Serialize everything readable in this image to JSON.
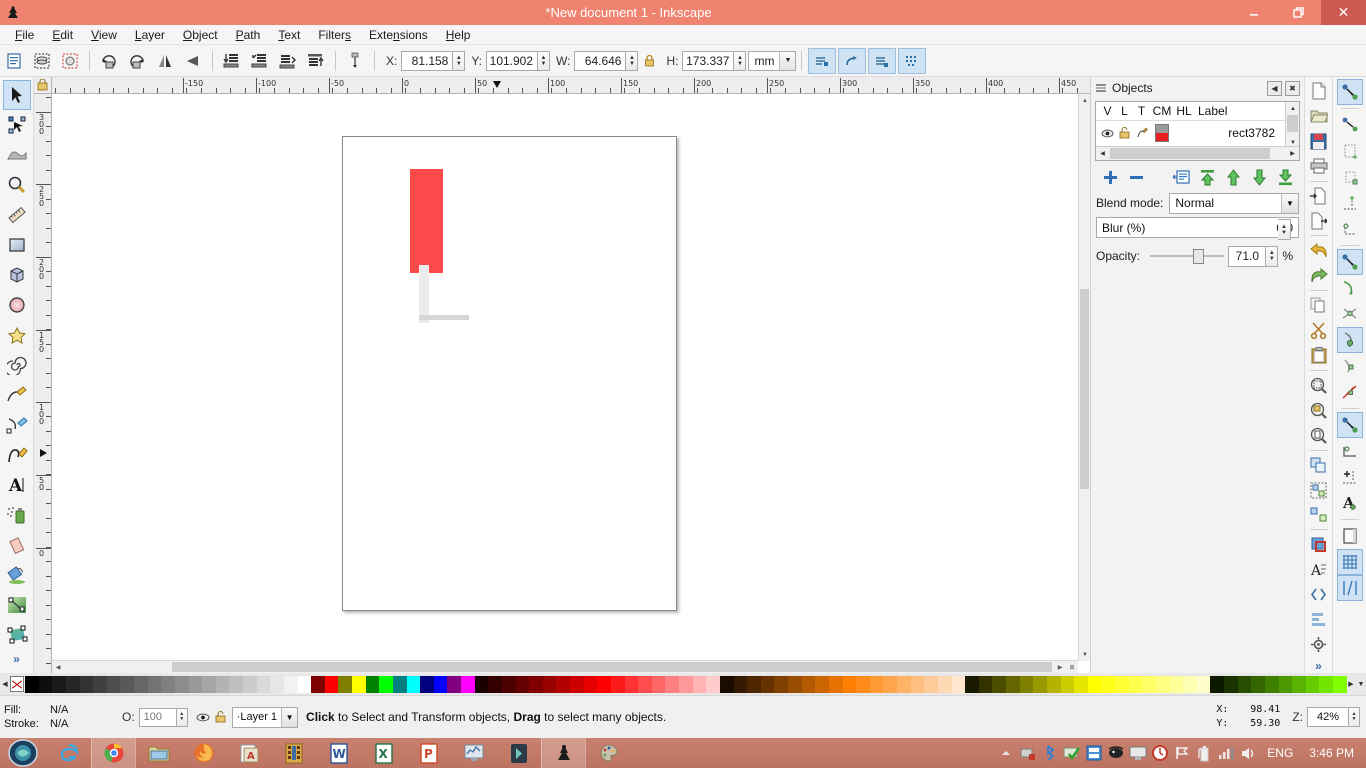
{
  "window": {
    "title": "*New document 1 - Inkscape",
    "app_icon": "inkscape-icon",
    "minimize": "–",
    "maximize": "❐",
    "close": "✕",
    "titlebar_color": "#f0836f",
    "close_color": "#cc5a52"
  },
  "menubar": {
    "items": [
      {
        "label": "File",
        "mnemonic": "F"
      },
      {
        "label": "Edit",
        "mnemonic": "E"
      },
      {
        "label": "View",
        "mnemonic": "V"
      },
      {
        "label": "Layer",
        "mnemonic": "L"
      },
      {
        "label": "Object",
        "mnemonic": "O"
      },
      {
        "label": "Path",
        "mnemonic": "P"
      },
      {
        "label": "Text",
        "mnemonic": "T"
      },
      {
        "label": "Filters",
        "mnemonic": "s"
      },
      {
        "label": "Extensions",
        "mnemonic": "n"
      },
      {
        "label": "Help",
        "mnemonic": "H"
      }
    ]
  },
  "toolcontrols": {
    "buttons": [
      {
        "name": "select-all-icon"
      },
      {
        "name": "select-all-in-all-layers-icon"
      },
      {
        "name": "deselect-icon"
      },
      {
        "name": "rotate-90-ccw-icon"
      },
      {
        "name": "rotate-90-cw-icon"
      },
      {
        "name": "flip-horizontal-icon"
      },
      {
        "name": "flip-vertical-icon"
      },
      {
        "name": "lower-to-bottom-icon"
      },
      {
        "name": "lower-icon"
      },
      {
        "name": "raise-icon"
      },
      {
        "name": "raise-to-top-icon"
      }
    ],
    "x_label": "X:",
    "x_value": "81.158",
    "y_label": "Y:",
    "y_value": "101.902",
    "w_label": "W:",
    "w_value": "64.646",
    "lock_icon": "lock-ratio-icon",
    "h_label": "H:",
    "h_value": "173.337",
    "unit": "mm",
    "affect_buttons": [
      {
        "name": "affect-stroke-width-icon"
      },
      {
        "name": "affect-rounded-corners-icon"
      },
      {
        "name": "affect-gradients-icon"
      },
      {
        "name": "affect-patterns-icon"
      }
    ]
  },
  "toolbox": {
    "tools": [
      {
        "name": "selector-tool",
        "icon": "arrow-cursor-icon",
        "active": true
      },
      {
        "name": "node-tool",
        "icon": "node-editor-icon",
        "active": false
      },
      {
        "name": "tweak-tool",
        "icon": "tweak-icon",
        "active": false
      },
      {
        "name": "zoom-tool",
        "icon": "magnifier-icon",
        "active": false
      },
      {
        "name": "measure-tool",
        "icon": "ruler-icon",
        "active": false
      },
      {
        "name": "rectangle-tool",
        "icon": "rectangle-icon",
        "active": false
      },
      {
        "name": "box3d-tool",
        "icon": "cube-icon",
        "active": false
      },
      {
        "name": "ellipse-tool",
        "icon": "circle-icon",
        "active": false
      },
      {
        "name": "star-tool",
        "icon": "star-icon",
        "active": false
      },
      {
        "name": "spiral-tool",
        "icon": "spiral-icon",
        "active": false
      },
      {
        "name": "pencil-tool",
        "icon": "pencil-icon",
        "active": false
      },
      {
        "name": "bezier-tool",
        "icon": "pen-icon",
        "active": false
      },
      {
        "name": "calligraphy-tool",
        "icon": "calligraphy-icon",
        "active": false
      },
      {
        "name": "text-tool",
        "icon": "letter-a-icon",
        "active": false
      },
      {
        "name": "spray-tool",
        "icon": "spray-can-icon",
        "active": false
      },
      {
        "name": "eraser-tool",
        "icon": "eraser-icon",
        "active": false
      },
      {
        "name": "paint-bucket-tool",
        "icon": "paint-bucket-icon",
        "active": false
      },
      {
        "name": "gradient-tool",
        "icon": "gradient-icon",
        "active": false
      },
      {
        "name": "mesh-gradient-tool",
        "icon": "mesh-gradient-icon",
        "active": false
      }
    ],
    "overflow": "»"
  },
  "rulers": {
    "unit_icon": "lock-icon",
    "h_labels": [
      "-150",
      "-100",
      "-50",
      "0",
      "50",
      "100",
      "150",
      "200",
      "250",
      "300",
      "350",
      "400",
      "450"
    ],
    "h_positions": [
      131,
      204,
      277,
      350,
      423,
      496,
      569,
      642,
      715,
      788,
      861,
      934,
      1007
    ],
    "v_labels": [
      "300",
      "250",
      "200",
      "150",
      "100",
      "50",
      "0"
    ],
    "v_positions": [
      18,
      90,
      163,
      236,
      308,
      381,
      454
    ]
  },
  "canvas": {
    "page_label": "document-page",
    "shapes": [
      {
        "name": "red-rectangle",
        "color": "#fc4a4a"
      },
      {
        "name": "grey-vertical-bar",
        "color": "#ececec"
      },
      {
        "name": "grey-horizontal-bar",
        "color": "#d6d6d6"
      }
    ]
  },
  "objects_panel": {
    "title": "Objects",
    "collapse_icon": "◀",
    "close_icon": "✖",
    "columns": [
      "V",
      "L",
      "T",
      "CM",
      "HL",
      "Label"
    ],
    "rows": [
      {
        "visible_icon": "eye-icon",
        "lock_icon": "unlock-icon",
        "type_icon": "object-type-icon",
        "swatch_top": "#9a9a9a",
        "swatch_bottom": "#e8201f",
        "label": "rect3782"
      }
    ],
    "buttons": [
      {
        "name": "add-object-button",
        "icon": "plus-icon"
      },
      {
        "name": "remove-object-button",
        "icon": "minus-icon"
      },
      {
        "name": "object-properties-button",
        "icon": "properties-icon"
      },
      {
        "name": "raise-to-top-button",
        "icon": "raise-to-top-icon"
      },
      {
        "name": "raise-button",
        "icon": "up-arrow-icon"
      },
      {
        "name": "lower-button",
        "icon": "down-arrow-icon"
      },
      {
        "name": "lower-to-bottom-button",
        "icon": "lower-to-bottom-icon"
      }
    ],
    "blend_mode_label": "Blend mode:",
    "blend_mode_value": "Normal",
    "blur_label": "Blur (%)",
    "blur_value": "0.0",
    "opacity_label": "Opacity:",
    "opacity_value": "71.0",
    "opacity_unit": "%",
    "opacity_percent": 71
  },
  "right_dock": {
    "buttons": [
      {
        "name": "new-document-button",
        "icon": "new-file-icon"
      },
      {
        "name": "open-document-button",
        "icon": "open-folder-icon"
      },
      {
        "name": "save-document-button",
        "icon": "floppy-disk-icon"
      },
      {
        "name": "print-document-button",
        "icon": "printer-icon"
      },
      {
        "name": "import-button",
        "icon": "import-icon"
      },
      {
        "name": "export-button",
        "icon": "export-icon"
      },
      {
        "name": "undo-button",
        "icon": "undo-arrow-icon"
      },
      {
        "name": "redo-button",
        "icon": "redo-arrow-icon"
      },
      {
        "name": "copy-button",
        "icon": "copy-icon"
      },
      {
        "name": "cut-button",
        "icon": "scissors-icon"
      },
      {
        "name": "paste-button",
        "icon": "clipboard-icon"
      },
      {
        "name": "zoom-selection-button",
        "icon": "zoom-selection-icon"
      },
      {
        "name": "zoom-drawing-button",
        "icon": "zoom-drawing-icon"
      },
      {
        "name": "zoom-page-button",
        "icon": "zoom-page-icon"
      },
      {
        "name": "duplicate-button",
        "icon": "duplicate-icon"
      },
      {
        "name": "group-button",
        "icon": "group-icon"
      },
      {
        "name": "ungroup-button",
        "icon": "ungroup-icon"
      },
      {
        "name": "fill-stroke-button",
        "icon": "fill-stroke-icon"
      },
      {
        "name": "text-properties-button",
        "icon": "text-properties-icon"
      },
      {
        "name": "xml-editor-button",
        "icon": "xml-editor-icon"
      },
      {
        "name": "align-distribute-button",
        "icon": "align-icon"
      },
      {
        "name": "preferences-button",
        "icon": "preferences-icon"
      }
    ],
    "overflow": "»"
  },
  "snap_toolbar": {
    "buttons": [
      {
        "name": "enable-snapping-toggle",
        "icon": "snap-master-icon",
        "on": true
      },
      {
        "name": "snap-bounding-boxes",
        "icon": "snap-bbox-icon",
        "on": false
      },
      {
        "name": "snap-bbox-edges",
        "icon": "snap-bbox-edge-icon",
        "on": false
      },
      {
        "name": "snap-bbox-corners",
        "icon": "snap-bbox-corner-icon",
        "on": false
      },
      {
        "name": "snap-bbox-edge-midpoints",
        "icon": "snap-bbox-midpoint-icon",
        "on": false
      },
      {
        "name": "snap-bbox-centers",
        "icon": "snap-bbox-center-icon",
        "on": false
      },
      {
        "name": "snap-nodes-paths",
        "icon": "snap-nodes-icon",
        "on": true
      },
      {
        "name": "snap-paths",
        "icon": "snap-path-icon",
        "on": false
      },
      {
        "name": "snap-path-intersections",
        "icon": "snap-intersection-icon",
        "on": false
      },
      {
        "name": "snap-cusp-nodes",
        "icon": "snap-cusp-icon",
        "on": true
      },
      {
        "name": "snap-smooth-nodes",
        "icon": "snap-smooth-icon",
        "on": false
      },
      {
        "name": "snap-midpoints-line-segments",
        "icon": "snap-line-midpoint-icon",
        "on": false
      },
      {
        "name": "snap-others",
        "icon": "snap-others-icon",
        "on": true
      },
      {
        "name": "snap-object-centers",
        "icon": "snap-object-center-icon",
        "on": false
      },
      {
        "name": "snap-rotation-centers",
        "icon": "snap-rotation-center-icon",
        "on": false
      },
      {
        "name": "snap-text-baselines",
        "icon": "snap-text-baseline-icon",
        "on": false
      },
      {
        "name": "snap-page-border",
        "icon": "snap-page-border-icon",
        "on": false
      },
      {
        "name": "snap-grids",
        "icon": "snap-grid-icon",
        "on": true
      },
      {
        "name": "snap-guides",
        "icon": "snap-guide-icon",
        "on": true
      }
    ]
  },
  "palette": {
    "no_color_icon": "no-color-x-icon",
    "colors": [
      "#000000",
      "#0d0d0d",
      "#1a1a1a",
      "#262626",
      "#333333",
      "#404040",
      "#4d4d4d",
      "#595959",
      "#666666",
      "#737373",
      "#808080",
      "#8c8c8c",
      "#999999",
      "#a6a6a6",
      "#b3b3b3",
      "#bfbfbf",
      "#cccccc",
      "#d9d9d9",
      "#e6e6e6",
      "#f2f2f2",
      "#ffffff",
      "#800000",
      "#ff0000",
      "#808000",
      "#ffff00",
      "#008000",
      "#00ff00",
      "#008080",
      "#00ffff",
      "#000080",
      "#0000ff",
      "#800080",
      "#ff00ff",
      "#1a0000",
      "#330000",
      "#4d0000",
      "#660000",
      "#800000",
      "#990000",
      "#b30000",
      "#cc0000",
      "#e60000",
      "#ff0000",
      "#ff1a1a",
      "#ff3333",
      "#ff4d4d",
      "#ff6666",
      "#ff8080",
      "#ff9999",
      "#ffb3b3",
      "#ffcccc",
      "#1a0d00",
      "#331a00",
      "#4d2600",
      "#663300",
      "#804000",
      "#994d00",
      "#b35900",
      "#cc6600",
      "#e67300",
      "#ff8000",
      "#ff8c1a",
      "#ff9933",
      "#ffa64d",
      "#ffb366",
      "#ffbf80",
      "#ffcc99",
      "#ffd9b3",
      "#ffe6cc",
      "#1a1a00",
      "#333300",
      "#4d4d00",
      "#666600",
      "#808000",
      "#999900",
      "#b3b300",
      "#cccc00",
      "#e6e600",
      "#ffff00",
      "#ffff1a",
      "#ffff33",
      "#ffff4d",
      "#ffff66",
      "#ffff80",
      "#ffff99",
      "#ffffb3",
      "#ffffcc",
      "#0d1a00",
      "#1a3300",
      "#264d00",
      "#336600",
      "#408000",
      "#4d9900",
      "#59b300",
      "#66cc00",
      "#73e600",
      "#80ff00"
    ],
    "left_arrow": "◀",
    "right_arrow": "▶",
    "menu_arrow": "▼"
  },
  "statusbar": {
    "fill_label": "Fill:",
    "fill_value": "N/A",
    "stroke_label": "Stroke:",
    "stroke_value": "N/A",
    "opacity_label": "O:",
    "opacity_value": "100",
    "layer_visibility_icon": "eye-icon",
    "layer_lock_icon": "unlock-icon",
    "layer_name": "·Layer 1",
    "layer_arrow": "∨",
    "message_bold_1": "Click",
    "message_text_1": " to Select and Transform objects, ",
    "message_bold_2": "Drag",
    "message_text_2": " to select many objects.",
    "x_label": "X:",
    "x_value": "98.41",
    "y_label": "Y:",
    "y_value": "59.30",
    "zoom_label": "Z:",
    "zoom_value": "42%"
  },
  "taskbar": {
    "start_icon": "start-orb-icon",
    "items": [
      {
        "name": "taskbar-internet-explorer",
        "icon": "internet-explorer-icon",
        "active": false
      },
      {
        "name": "taskbar-chrome",
        "icon": "chrome-icon",
        "active": true
      },
      {
        "name": "taskbar-file-explorer",
        "icon": "folder-icon",
        "active": false
      },
      {
        "name": "taskbar-firefox",
        "icon": "firefox-icon",
        "active": false
      },
      {
        "name": "taskbar-pdf-reader",
        "icon": "pdf-reader-icon",
        "active": false
      },
      {
        "name": "taskbar-media",
        "icon": "media-icon",
        "active": false
      },
      {
        "name": "taskbar-word",
        "icon": "word-icon",
        "active": false
      },
      {
        "name": "taskbar-excel",
        "icon": "excel-icon",
        "active": false
      },
      {
        "name": "taskbar-powerpoint",
        "icon": "powerpoint-icon",
        "active": false
      },
      {
        "name": "taskbar-monitor-app",
        "icon": "monitor-chart-icon",
        "active": false
      },
      {
        "name": "taskbar-dark-app",
        "icon": "dark-app-icon",
        "active": false
      },
      {
        "name": "taskbar-inkscape",
        "icon": "inkscape-icon",
        "active": true
      },
      {
        "name": "taskbar-paint-app",
        "icon": "paint-palette-icon",
        "active": false
      }
    ],
    "tray": [
      {
        "name": "tray-show-hidden",
        "icon": "chevron-up-icon"
      },
      {
        "name": "tray-network-error",
        "icon": "network-error-icon"
      },
      {
        "name": "tray-bluetooth",
        "icon": "bluetooth-icon"
      },
      {
        "name": "tray-antivirus",
        "icon": "antivirus-shield-icon"
      },
      {
        "name": "tray-blue-app",
        "icon": "blue-app-icon"
      },
      {
        "name": "tray-pirate",
        "icon": "pirate-icon"
      },
      {
        "name": "tray-display",
        "icon": "display-icon"
      },
      {
        "name": "tray-timer",
        "icon": "timer-icon"
      },
      {
        "name": "tray-flag",
        "icon": "flag-icon"
      },
      {
        "name": "tray-battery",
        "icon": "battery-icon"
      },
      {
        "name": "tray-signal",
        "icon": "signal-bars-icon"
      },
      {
        "name": "tray-volume",
        "icon": "speaker-icon"
      }
    ],
    "language": "ENG",
    "clock": "3:46 PM"
  }
}
